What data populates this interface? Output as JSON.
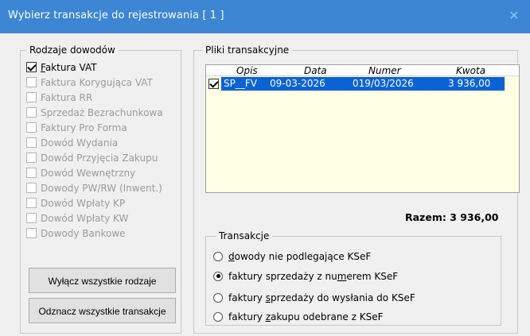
{
  "window": {
    "title": "Wybierz transakcje do rejestrowania  [ 1 ]",
    "close_icon": "close-icon",
    "title_color": "#3c86d4"
  },
  "doc_types": {
    "legend": "Rodzaje dowodów",
    "items": [
      {
        "label_pre": "",
        "label_ul": "F",
        "label_post": "aktura VAT",
        "checked": true,
        "enabled": true
      },
      {
        "label_pre": "Faktura Korygująca VAT",
        "label_ul": "",
        "label_post": "",
        "checked": false,
        "enabled": false
      },
      {
        "label_pre": "Faktura RR",
        "label_ul": "",
        "label_post": "",
        "checked": false,
        "enabled": false
      },
      {
        "label_pre": "Sprzedaż Bezrachunkowa",
        "label_ul": "",
        "label_post": "",
        "checked": false,
        "enabled": false
      },
      {
        "label_pre": "Faktury Pro Forma",
        "label_ul": "",
        "label_post": "",
        "checked": false,
        "enabled": false
      },
      {
        "label_pre": "Dowód Wydania",
        "label_ul": "",
        "label_post": "",
        "checked": false,
        "enabled": false
      },
      {
        "label_pre": "Dowód Przyjęcia Zakupu",
        "label_ul": "",
        "label_post": "",
        "checked": false,
        "enabled": false
      },
      {
        "label_pre": "Dowód Wewnętrzny",
        "label_ul": "",
        "label_post": "",
        "checked": false,
        "enabled": false
      },
      {
        "label_pre": "Dowody PW/RW (Inwent.)",
        "label_ul": "",
        "label_post": "",
        "checked": false,
        "enabled": false
      },
      {
        "label_pre": "Dowód Wpłaty KP",
        "label_ul": "",
        "label_post": "",
        "checked": false,
        "enabled": false
      },
      {
        "label_pre": "Dowód Wpłaty KW",
        "label_ul": "",
        "label_post": "",
        "checked": false,
        "enabled": false
      },
      {
        "label_pre": "Dowody Bankowe",
        "label_ul": "",
        "label_post": "",
        "checked": false,
        "enabled": false
      }
    ],
    "btn_disable_all": "Wyłącz wszystkie rodzaje",
    "btn_select_all": "Odznacz wszystkie transakcje"
  },
  "files": {
    "legend": "Pliki transakcyjne",
    "columns": [
      "Opis",
      "Data",
      "Numer",
      "Kwota"
    ],
    "rows": [
      {
        "checked": true,
        "opis": "SP__FV",
        "data": "09-03-2026",
        "numer": "019/03/2026",
        "kwota": "3 936,00"
      }
    ],
    "total_label": "Razem:",
    "total_value": "3 936,00",
    "list_bg": "#ffffe6",
    "selection_color": "#0a63d6"
  },
  "transactions": {
    "legend": "Transakcje",
    "options": [
      {
        "pre": "",
        "ul": "d",
        "post": "owody nie podlegające KSeF",
        "checked": false
      },
      {
        "pre": "faktury sprzedaży z nu",
        "ul": "m",
        "post": "erem KSeF",
        "checked": true
      },
      {
        "pre": "faktury ",
        "ul": "s",
        "post": "przedaży do wysłania do KSeF",
        "checked": false
      },
      {
        "pre": "faktury ",
        "ul": "z",
        "post": "akupu odebrane z KSeF",
        "checked": false
      }
    ]
  }
}
